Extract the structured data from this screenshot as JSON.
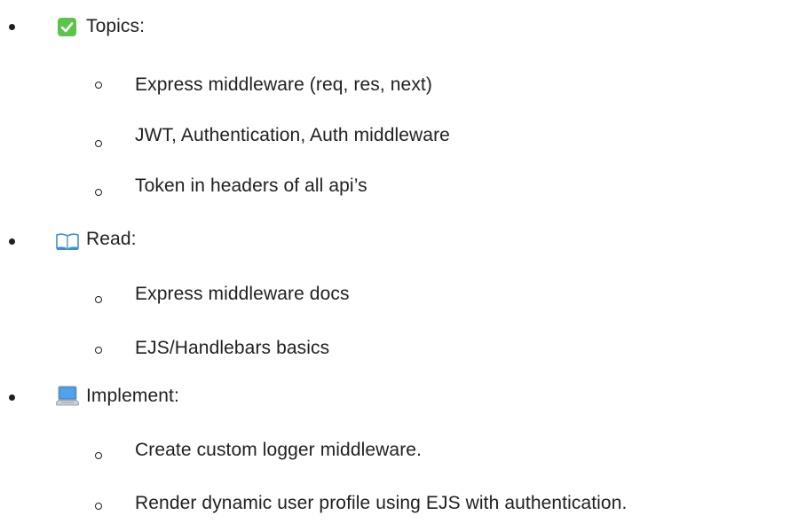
{
  "sections": [
    {
      "icon": "check-mark-button-icon",
      "heading": "Topics:",
      "items": [
        "Express middleware (req, res, next)",
        "JWT, Authentication, Auth middleware",
        "Token in headers of all api’s"
      ]
    },
    {
      "icon": "open-book-icon",
      "heading": "Read:",
      "items": [
        "Express middleware docs",
        "EJS/Handlebars basics"
      ]
    },
    {
      "icon": "laptop-icon",
      "heading": "Implement:",
      "items": [
        "Create custom logger middleware.",
        "Render dynamic user profile using EJS with authentication."
      ]
    }
  ]
}
